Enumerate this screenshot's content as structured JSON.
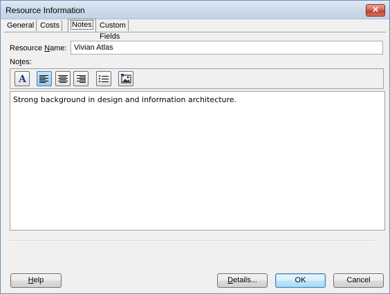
{
  "window": {
    "title": "Resource Information"
  },
  "tabs": [
    {
      "label": "General"
    },
    {
      "label": "Costs"
    },
    {
      "label": "Notes"
    },
    {
      "label": "Custom Fields"
    }
  ],
  "resource_name": {
    "label_pre": "Resource ",
    "label_mnemonic": "N",
    "label_post": "ame:",
    "value": "Vivian Atlas"
  },
  "notes": {
    "label_pre": "No",
    "label_mnemonic": "t",
    "label_post": "es:",
    "text": "Strong background in design and information architecture."
  },
  "toolbar": {
    "buttons": [
      {
        "icon": "font-icon"
      },
      {
        "icon": "align-left-icon",
        "pressed": true
      },
      {
        "icon": "align-center-icon"
      },
      {
        "icon": "align-right-icon"
      },
      {
        "icon": "bullet-list-icon"
      },
      {
        "icon": "insert-object-icon"
      }
    ]
  },
  "buttons": {
    "help_mnemonic": "H",
    "help_rest": "elp",
    "details_mnemonic": "D",
    "details_rest": "etails...",
    "ok": "OK",
    "cancel": "Cancel"
  },
  "colors": {
    "title_bar": "#cddbeb",
    "close_button": "#c2412a",
    "default_button_border": "#3c7fb1"
  }
}
